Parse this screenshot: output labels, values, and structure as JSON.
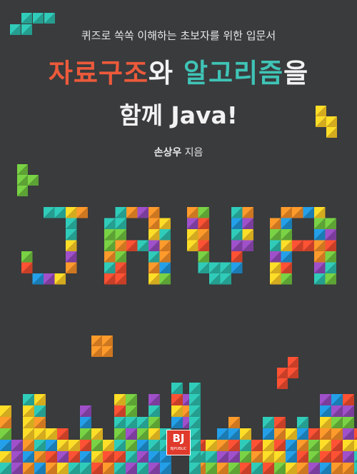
{
  "cover": {
    "subtitle": "퀴즈로 쏙쏙 이해하는 초보자를 위한 입문서",
    "title_part1": "자료구조",
    "title_part2": "와 ",
    "title_part3": "알고리즘",
    "title_part4": "을",
    "title_line2": "함께 Java!",
    "author_name": "손상우",
    "author_suffix": " 지음",
    "art_word": "JAVA",
    "publisher_logo": "BJ",
    "publisher_name": "BJPUBLIC"
  },
  "colors": {
    "background": "#393b3d",
    "title_red": "#ec5a3b",
    "title_teal": "#3fc4b6",
    "tile_palette": [
      "#f6c624",
      "#f08a26",
      "#e8492e",
      "#2bb6a6",
      "#8f47b4",
      "#1f8fd0",
      "#6cbc3d"
    ]
  }
}
